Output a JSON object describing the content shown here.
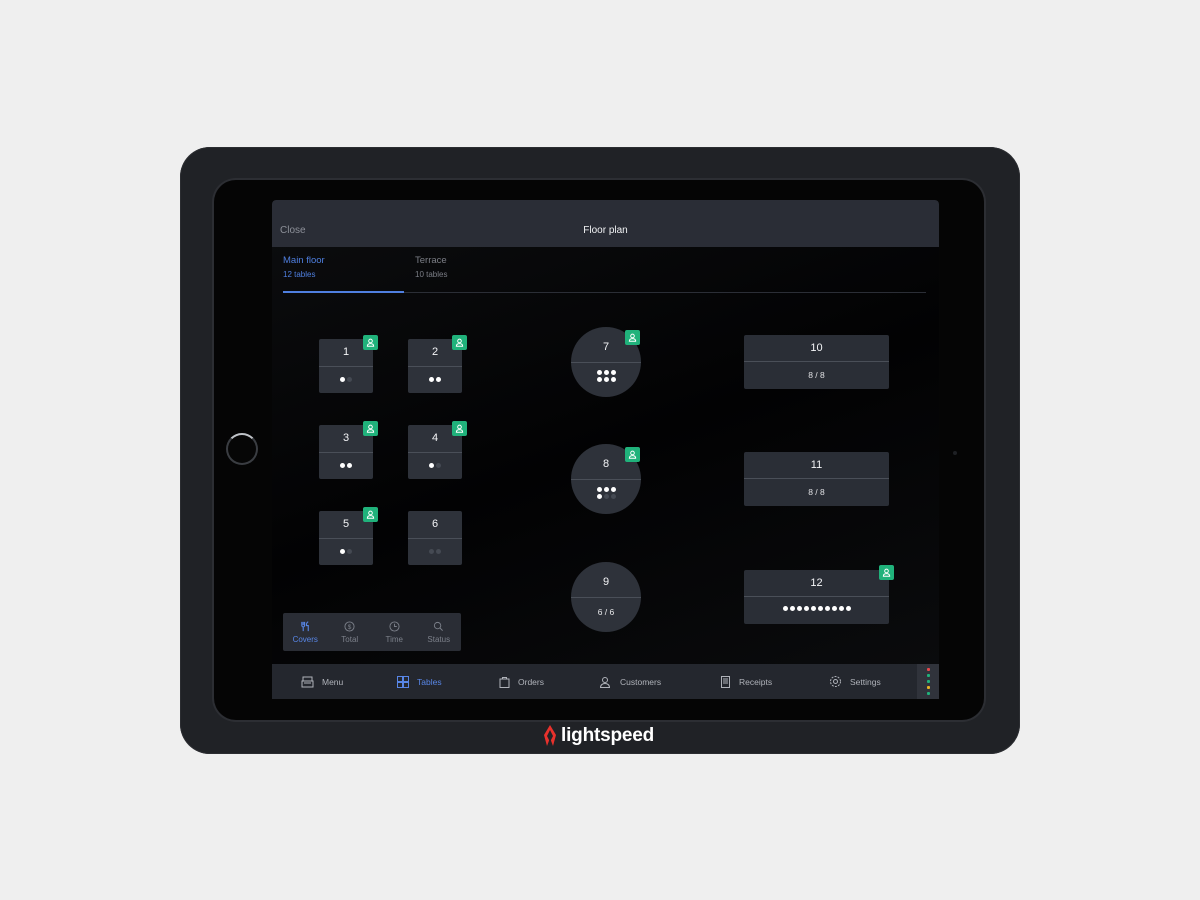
{
  "device": {
    "brand": "lightspeed",
    "brand_color": "#e8312c"
  },
  "header": {
    "close_label": "Close",
    "title": "Floor plan"
  },
  "tabs": [
    {
      "name": "Main floor",
      "count": "12 tables",
      "active": true
    },
    {
      "name": "Terrace",
      "count": "10 tables",
      "active": false
    }
  ],
  "tables": [
    {
      "number": "1",
      "shape": "square",
      "seats": 2,
      "occupied": 1,
      "customer_badge": true
    },
    {
      "number": "2",
      "shape": "square",
      "seats": 2,
      "occupied": 2,
      "customer_badge": true
    },
    {
      "number": "3",
      "shape": "square",
      "seats": 2,
      "occupied": 2,
      "customer_badge": true
    },
    {
      "number": "4",
      "shape": "square",
      "seats": 2,
      "occupied": 1,
      "customer_badge": true
    },
    {
      "number": "5",
      "shape": "square",
      "seats": 2,
      "occupied": 1,
      "customer_badge": true
    },
    {
      "number": "6",
      "shape": "square",
      "seats": 2,
      "occupied": 0,
      "customer_badge": false
    },
    {
      "number": "7",
      "shape": "round",
      "seats": 6,
      "occupied": 6,
      "customer_badge": true
    },
    {
      "number": "8",
      "shape": "round",
      "seats": 6,
      "occupied": 4,
      "customer_badge": true
    },
    {
      "number": "9",
      "shape": "round",
      "seats": 6,
      "occupied": 6,
      "label": "6 / 6",
      "customer_badge": false
    },
    {
      "number": "10",
      "shape": "rect",
      "seats": 8,
      "occupied": 8,
      "label": "8 / 8",
      "customer_badge": false
    },
    {
      "number": "11",
      "shape": "rect",
      "seats": 8,
      "occupied": 8,
      "label": "8 / 8",
      "customer_badge": false
    },
    {
      "number": "12",
      "shape": "rect",
      "seats": 10,
      "occupied": 10,
      "customer_badge": true
    }
  ],
  "sort_options": [
    {
      "label": "Covers",
      "icon": "cutlery-icon",
      "active": true
    },
    {
      "label": "Total",
      "icon": "dollar-icon",
      "active": false
    },
    {
      "label": "Time",
      "icon": "clock-icon",
      "active": false
    },
    {
      "label": "Status",
      "icon": "search-icon",
      "active": false
    }
  ],
  "nav": [
    {
      "label": "Menu",
      "icon": "register-icon",
      "active": false
    },
    {
      "label": "Tables",
      "icon": "grid-icon",
      "active": true
    },
    {
      "label": "Orders",
      "icon": "bag-icon",
      "active": false
    },
    {
      "label": "Customers",
      "icon": "customers-icon",
      "active": false
    },
    {
      "label": "Receipts",
      "icon": "receipt-icon",
      "active": false
    },
    {
      "label": "Settings",
      "icon": "gear-icon",
      "active": false
    }
  ],
  "status_indicators": [
    "#e5484d",
    "#20b27b",
    "#20b27b",
    "#e6b325",
    "#20b27b"
  ],
  "colors": {
    "accent": "#4f7fe0",
    "badge": "#20b27b",
    "table_bg": "#2e323a"
  }
}
